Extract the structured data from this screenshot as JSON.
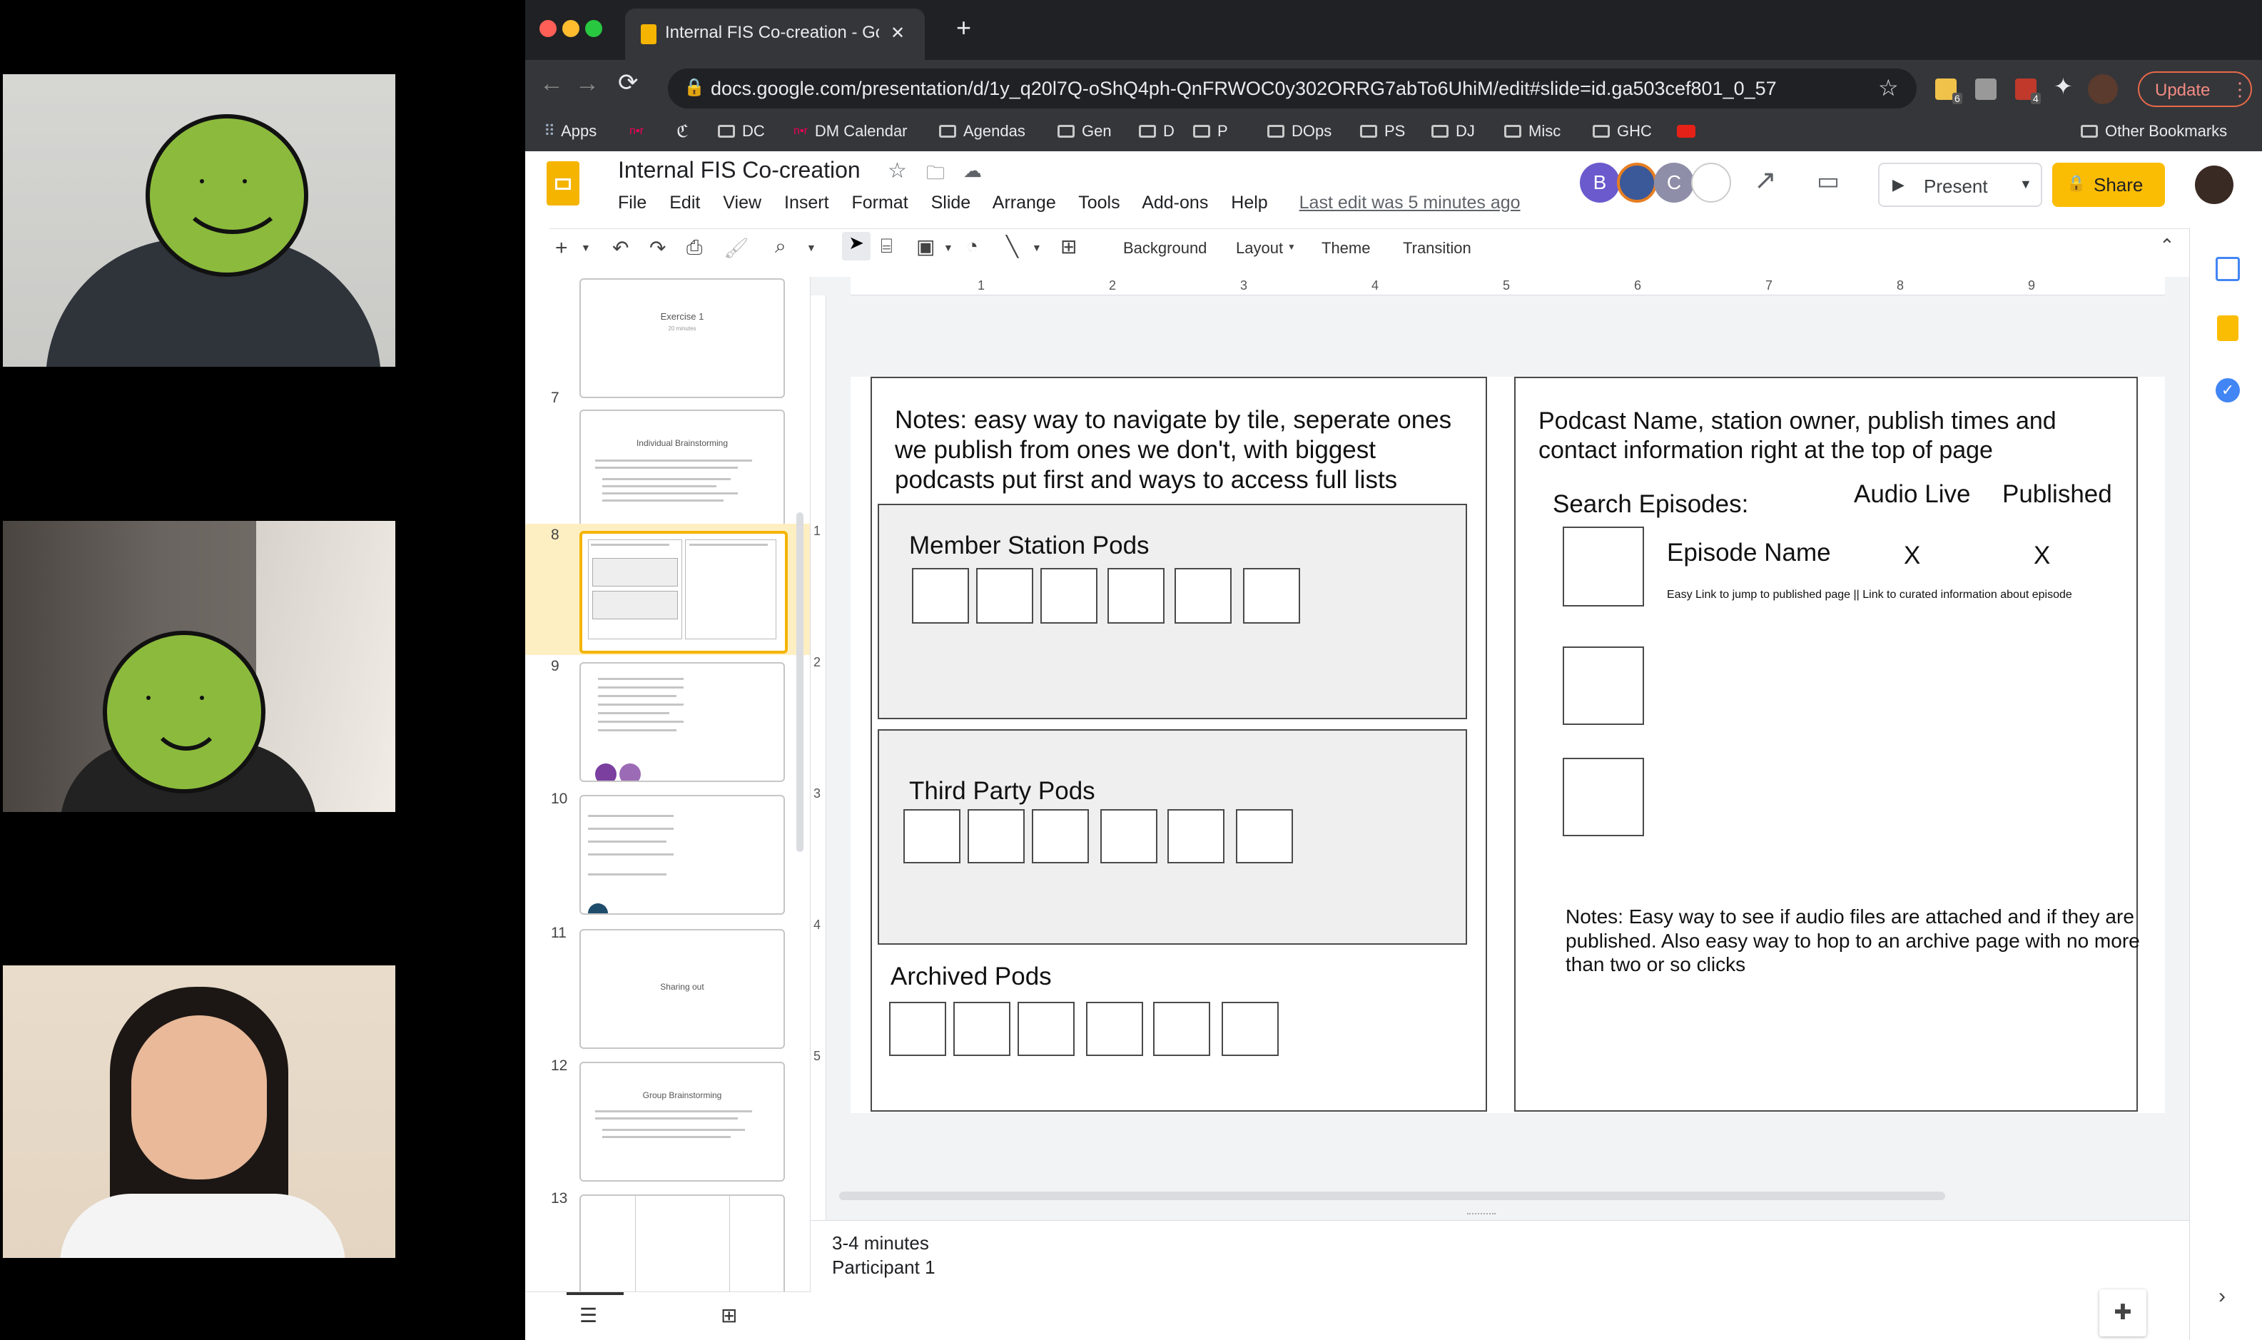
{
  "video": {
    "participants": [
      {
        "type": "masked"
      },
      {
        "type": "masked"
      },
      {
        "type": "visible"
      }
    ]
  },
  "browser": {
    "tab_title": "Internal FIS Co-creation - Goog",
    "new_tab": "+",
    "tab_close": "✕",
    "url": "docs.google.com/presentation/d/1y_q20l7Q-oShQ4ph-QnFRWOC0y302ORRG7abTo6UhiM/edit#slide=id.ga503cef801_0_57",
    "update_label": "Update",
    "ext_badge_1": "6",
    "ext_badge_2": "4",
    "bookmarks": [
      "Apps",
      "DC",
      "DM Calendar",
      "Agendas",
      "Gen",
      "D",
      "P",
      "DOps",
      "PS",
      "DJ",
      "Misc",
      "GHC"
    ],
    "other_bookmarks": "Other Bookmarks"
  },
  "docs": {
    "title": "Internal FIS Co-creation",
    "menu": [
      "File",
      "Edit",
      "View",
      "Insert",
      "Format",
      "Slide",
      "Arrange",
      "Tools",
      "Add-ons",
      "Help"
    ],
    "last_edit": "Last edit was 5 minutes ago",
    "avatars": [
      "B",
      "",
      "C"
    ],
    "present_label": "Present",
    "share_label": "Share",
    "toolbar": {
      "background": "Background",
      "layout": "Layout",
      "theme": "Theme",
      "transition": "Transition"
    },
    "ruler_h": [
      "1",
      "2",
      "3",
      "4",
      "5",
      "6",
      "7",
      "8",
      "9"
    ],
    "ruler_v": [
      "1",
      "2",
      "3",
      "4",
      "5"
    ],
    "speaker_notes": [
      "3-4 minutes",
      "Participant 1"
    ]
  },
  "thumbnails": [
    {
      "num": "",
      "title": "Exercise 1",
      "sub": "20 minutes"
    },
    {
      "num": "7",
      "title": "Individual Brainstorming",
      "sub": ""
    },
    {
      "num": "8",
      "title": "",
      "sub": "",
      "selected": true
    },
    {
      "num": "9",
      "title": "",
      "sub": ""
    },
    {
      "num": "10",
      "title": "",
      "sub": ""
    },
    {
      "num": "11",
      "title": "Sharing out",
      "sub": ""
    },
    {
      "num": "12",
      "title": "Group Brainstorming",
      "sub": ""
    },
    {
      "num": "13",
      "title": "",
      "sub": ""
    }
  ],
  "slide": {
    "left": {
      "notes": "Notes: easy way to navigate by tile, seperate ones we publish from ones we don't, with biggest podcasts put first and ways to access full lists",
      "member_title": "Member Station Pods",
      "third_title": "Third Party Pods",
      "archived_title": "Archived Pods"
    },
    "right": {
      "header": "Podcast Name, station owner, publish times and contact information right at the top of page",
      "search": "Search Episodes:",
      "col_audio": "Audio Live",
      "col_published": "Published",
      "episode_name": "Episode Name",
      "x1": "X",
      "x2": "X",
      "links": "Easy Link to jump to published page  ||  Link to curated information about episode",
      "notes": "Notes: Easy way to see if audio files are attached and if they are published. Also easy way to hop to an archive page with no more than two or so clicks"
    }
  }
}
